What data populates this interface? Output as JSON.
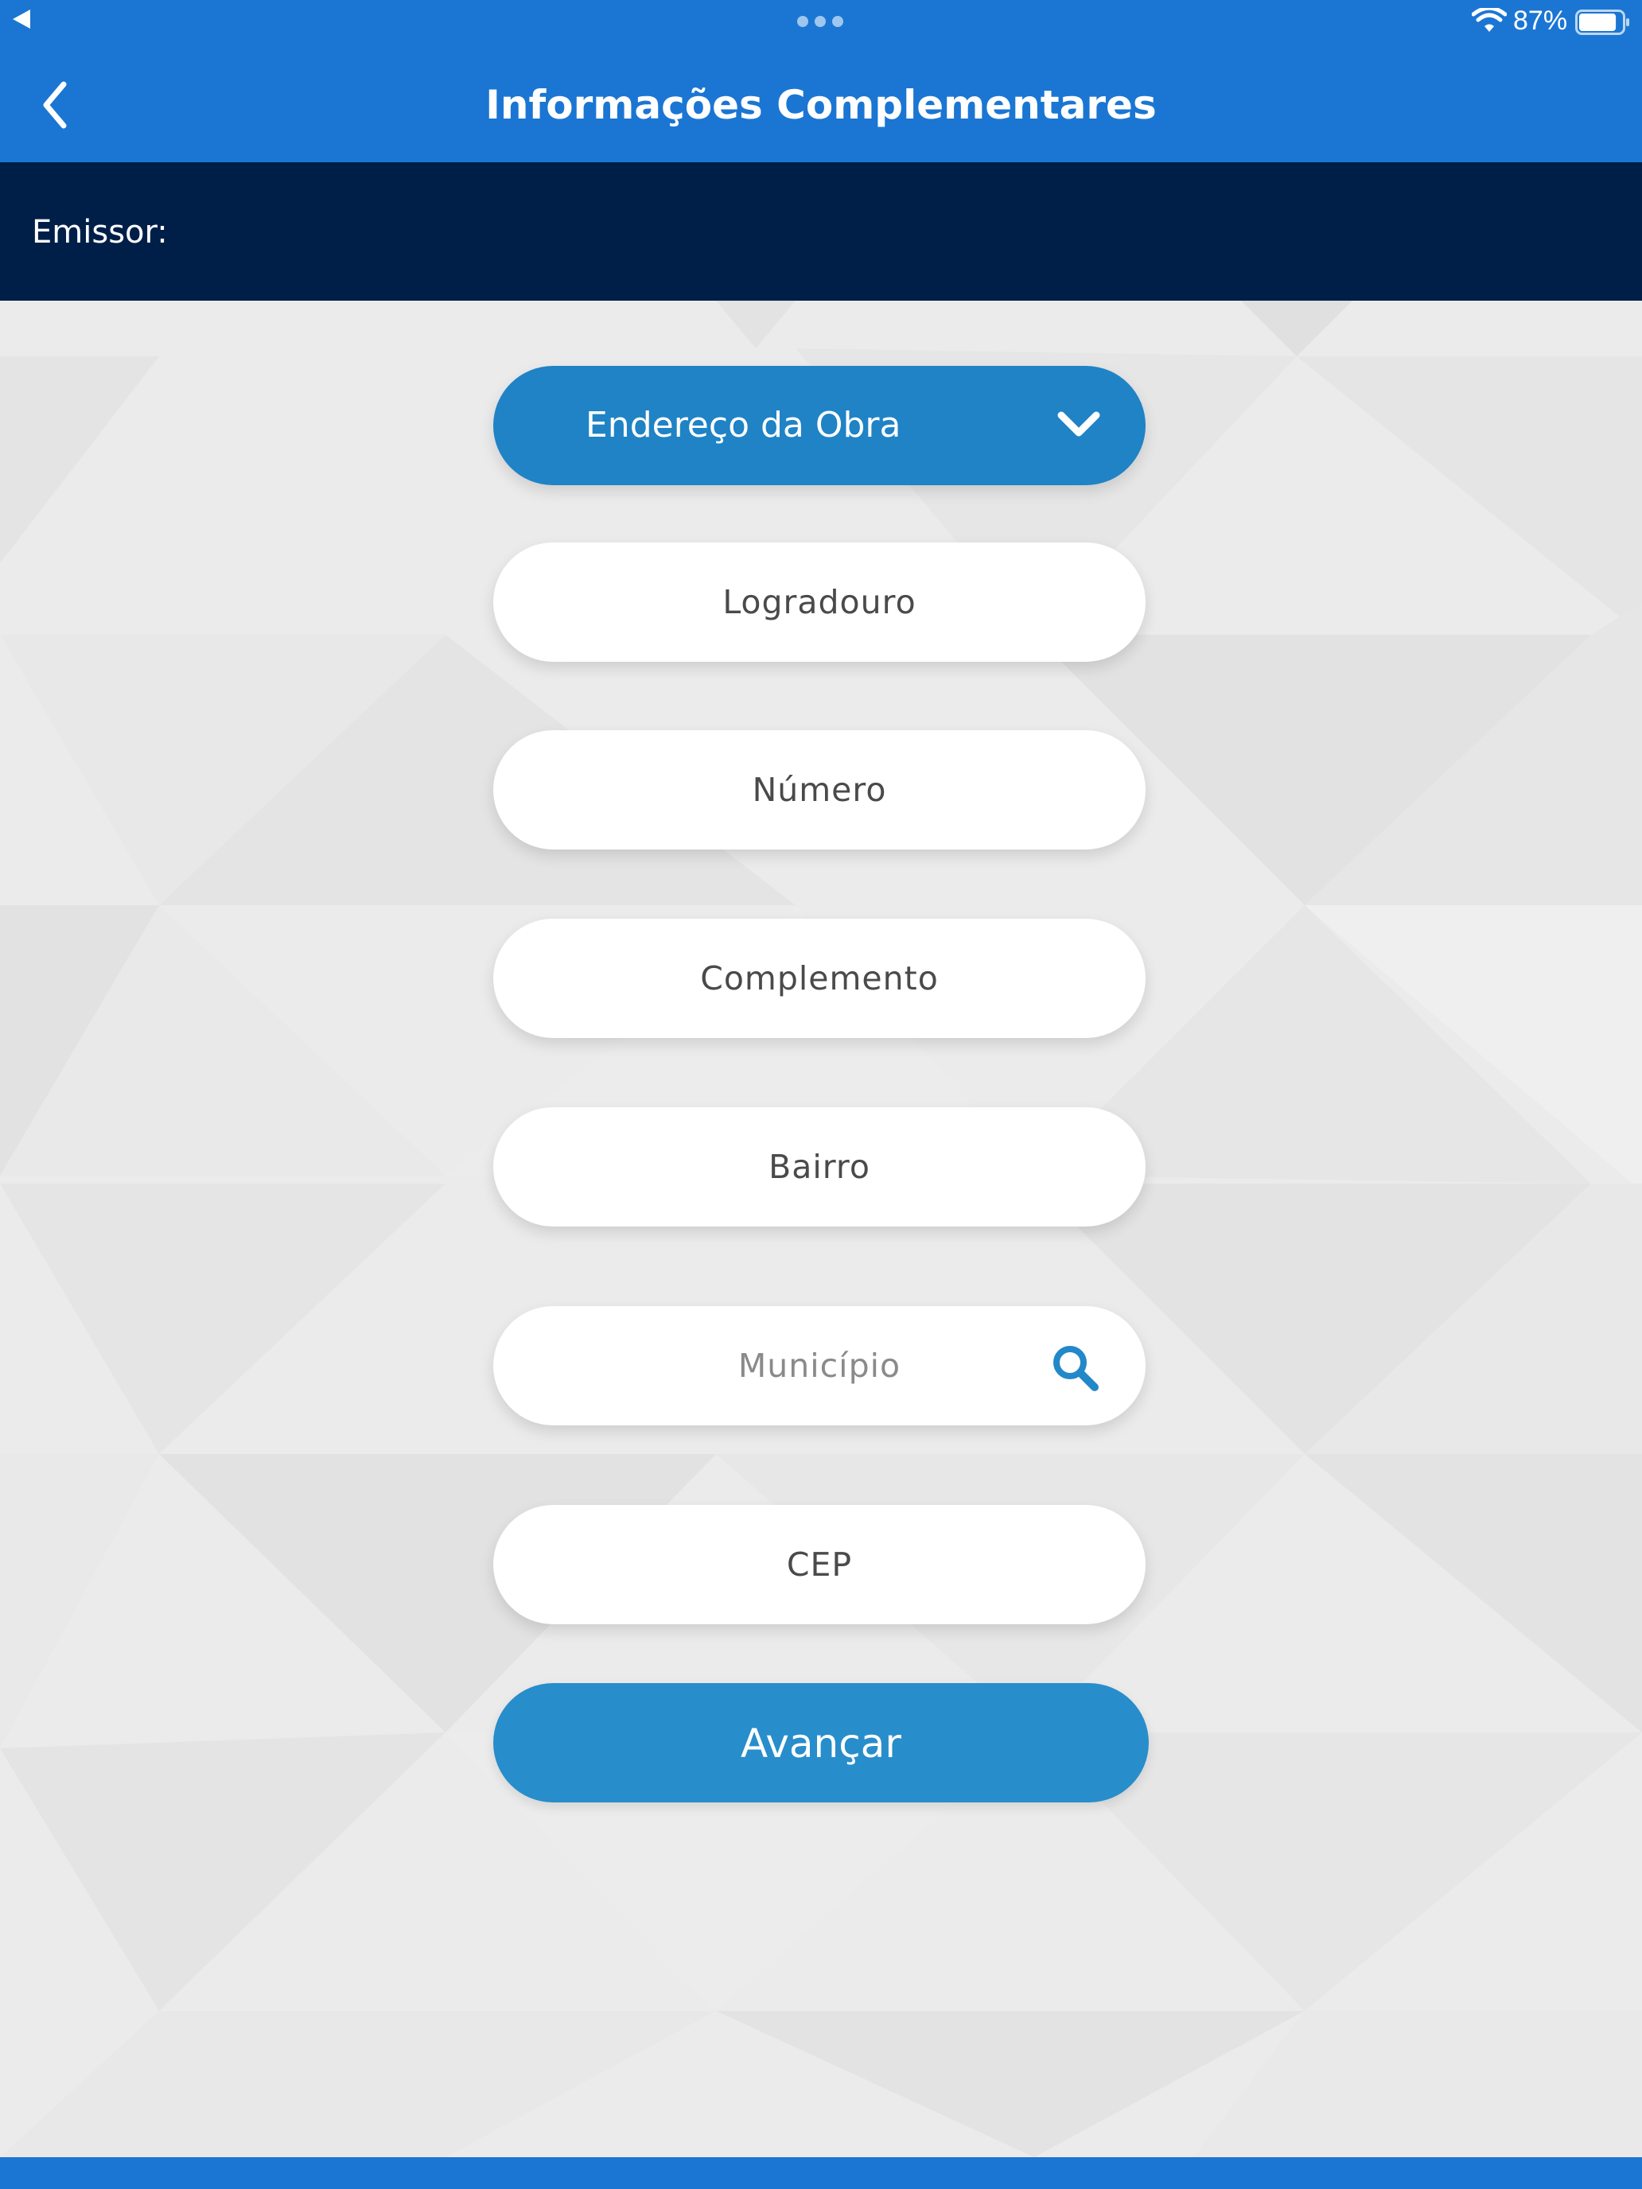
{
  "status_bar": {
    "battery_percent": "87%",
    "battery_level": 0.87,
    "icons": [
      "back-arrow-icon",
      "multitask-dots-icon",
      "wifi-icon",
      "battery-icon"
    ]
  },
  "header": {
    "title": "Informações Complementares",
    "back_icon": "chevron-left-icon"
  },
  "emissor": {
    "label": "Emissor:"
  },
  "form": {
    "section_dropdown": {
      "selected": "Endereço da Obra",
      "icon": "chevron-down-icon"
    },
    "fields": {
      "logradouro": "Logradouro",
      "numero": "Número",
      "complemento": "Complemento",
      "bairro": "Bairro",
      "municipio": "Município",
      "cep": "CEP"
    },
    "municipio_icon": "search-icon",
    "submit_label": "Avançar"
  },
  "colors": {
    "header_blue": "#1b76d3",
    "emissor_navy": "#001f48",
    "dropdown_blue": "#1f83c6",
    "button_blue": "#288dcb",
    "background_gray": "#eaeaea"
  }
}
